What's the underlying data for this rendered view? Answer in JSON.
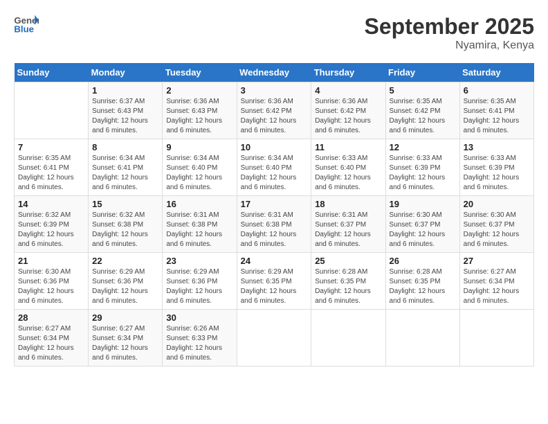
{
  "header": {
    "logo_general": "General",
    "logo_blue": "Blue",
    "month": "September 2025",
    "location": "Nyamira, Kenya"
  },
  "days_of_week": [
    "Sunday",
    "Monday",
    "Tuesday",
    "Wednesday",
    "Thursday",
    "Friday",
    "Saturday"
  ],
  "weeks": [
    [
      {
        "day": "",
        "sunrise": "",
        "sunset": "",
        "daylight": ""
      },
      {
        "day": "1",
        "sunrise": "6:37 AM",
        "sunset": "6:43 PM",
        "daylight": "12 hours and 6 minutes."
      },
      {
        "day": "2",
        "sunrise": "6:36 AM",
        "sunset": "6:43 PM",
        "daylight": "12 hours and 6 minutes."
      },
      {
        "day": "3",
        "sunrise": "6:36 AM",
        "sunset": "6:42 PM",
        "daylight": "12 hours and 6 minutes."
      },
      {
        "day": "4",
        "sunrise": "6:36 AM",
        "sunset": "6:42 PM",
        "daylight": "12 hours and 6 minutes."
      },
      {
        "day": "5",
        "sunrise": "6:35 AM",
        "sunset": "6:42 PM",
        "daylight": "12 hours and 6 minutes."
      },
      {
        "day": "6",
        "sunrise": "6:35 AM",
        "sunset": "6:41 PM",
        "daylight": "12 hours and 6 minutes."
      }
    ],
    [
      {
        "day": "7",
        "sunrise": "6:35 AM",
        "sunset": "6:41 PM",
        "daylight": "12 hours and 6 minutes."
      },
      {
        "day": "8",
        "sunrise": "6:34 AM",
        "sunset": "6:41 PM",
        "daylight": "12 hours and 6 minutes."
      },
      {
        "day": "9",
        "sunrise": "6:34 AM",
        "sunset": "6:40 PM",
        "daylight": "12 hours and 6 minutes."
      },
      {
        "day": "10",
        "sunrise": "6:34 AM",
        "sunset": "6:40 PM",
        "daylight": "12 hours and 6 minutes."
      },
      {
        "day": "11",
        "sunrise": "6:33 AM",
        "sunset": "6:40 PM",
        "daylight": "12 hours and 6 minutes."
      },
      {
        "day": "12",
        "sunrise": "6:33 AM",
        "sunset": "6:39 PM",
        "daylight": "12 hours and 6 minutes."
      },
      {
        "day": "13",
        "sunrise": "6:33 AM",
        "sunset": "6:39 PM",
        "daylight": "12 hours and 6 minutes."
      }
    ],
    [
      {
        "day": "14",
        "sunrise": "6:32 AM",
        "sunset": "6:39 PM",
        "daylight": "12 hours and 6 minutes."
      },
      {
        "day": "15",
        "sunrise": "6:32 AM",
        "sunset": "6:38 PM",
        "daylight": "12 hours and 6 minutes."
      },
      {
        "day": "16",
        "sunrise": "6:31 AM",
        "sunset": "6:38 PM",
        "daylight": "12 hours and 6 minutes."
      },
      {
        "day": "17",
        "sunrise": "6:31 AM",
        "sunset": "6:38 PM",
        "daylight": "12 hours and 6 minutes."
      },
      {
        "day": "18",
        "sunrise": "6:31 AM",
        "sunset": "6:37 PM",
        "daylight": "12 hours and 6 minutes."
      },
      {
        "day": "19",
        "sunrise": "6:30 AM",
        "sunset": "6:37 PM",
        "daylight": "12 hours and 6 minutes."
      },
      {
        "day": "20",
        "sunrise": "6:30 AM",
        "sunset": "6:37 PM",
        "daylight": "12 hours and 6 minutes."
      }
    ],
    [
      {
        "day": "21",
        "sunrise": "6:30 AM",
        "sunset": "6:36 PM",
        "daylight": "12 hours and 6 minutes."
      },
      {
        "day": "22",
        "sunrise": "6:29 AM",
        "sunset": "6:36 PM",
        "daylight": "12 hours and 6 minutes."
      },
      {
        "day": "23",
        "sunrise": "6:29 AM",
        "sunset": "6:36 PM",
        "daylight": "12 hours and 6 minutes."
      },
      {
        "day": "24",
        "sunrise": "6:29 AM",
        "sunset": "6:35 PM",
        "daylight": "12 hours and 6 minutes."
      },
      {
        "day": "25",
        "sunrise": "6:28 AM",
        "sunset": "6:35 PM",
        "daylight": "12 hours and 6 minutes."
      },
      {
        "day": "26",
        "sunrise": "6:28 AM",
        "sunset": "6:35 PM",
        "daylight": "12 hours and 6 minutes."
      },
      {
        "day": "27",
        "sunrise": "6:27 AM",
        "sunset": "6:34 PM",
        "daylight": "12 hours and 6 minutes."
      }
    ],
    [
      {
        "day": "28",
        "sunrise": "6:27 AM",
        "sunset": "6:34 PM",
        "daylight": "12 hours and 6 minutes."
      },
      {
        "day": "29",
        "sunrise": "6:27 AM",
        "sunset": "6:34 PM",
        "daylight": "12 hours and 6 minutes."
      },
      {
        "day": "30",
        "sunrise": "6:26 AM",
        "sunset": "6:33 PM",
        "daylight": "12 hours and 6 minutes."
      },
      {
        "day": "",
        "sunrise": "",
        "sunset": "",
        "daylight": ""
      },
      {
        "day": "",
        "sunrise": "",
        "sunset": "",
        "daylight": ""
      },
      {
        "day": "",
        "sunrise": "",
        "sunset": "",
        "daylight": ""
      },
      {
        "day": "",
        "sunrise": "",
        "sunset": "",
        "daylight": ""
      }
    ]
  ]
}
